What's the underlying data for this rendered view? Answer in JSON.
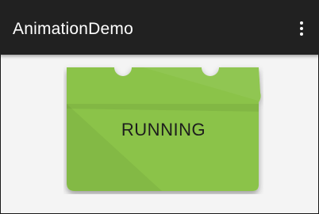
{
  "toolbar": {
    "title": "AnimationDemo",
    "overflow_icon": "more-vert-icon",
    "background": "#212121"
  },
  "card": {
    "status": "RUNNING",
    "color": "#8bc34a"
  }
}
